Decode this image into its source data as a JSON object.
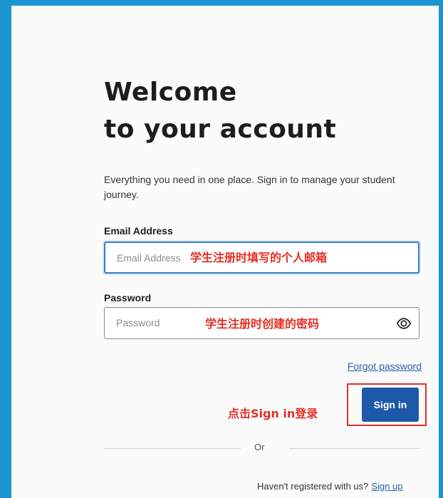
{
  "heading": {
    "line1": "Welcome",
    "line2": "to your account"
  },
  "subtitle": "Everything you need in one place. Sign in to manage your student journey.",
  "email": {
    "label": "Email Address",
    "placeholder": "Email Address",
    "annotation": "学生注册时填写的个人邮箱"
  },
  "password": {
    "label": "Password",
    "placeholder": "Password",
    "annotation": "学生注册时创建的密码",
    "toggle_icon": "eye-icon"
  },
  "forgot_password": "Forgot password",
  "sign_in": {
    "label": "Sign in",
    "annotation": "点击Sign in登录"
  },
  "divider_text": "Or",
  "footer": {
    "prompt": "Haven't registered with us?",
    "link": "Sign up"
  },
  "colors": {
    "frame": "#1b95d0",
    "primary": "#1e58a8",
    "annotation": "#e52e26",
    "link": "#2c5fa6"
  }
}
